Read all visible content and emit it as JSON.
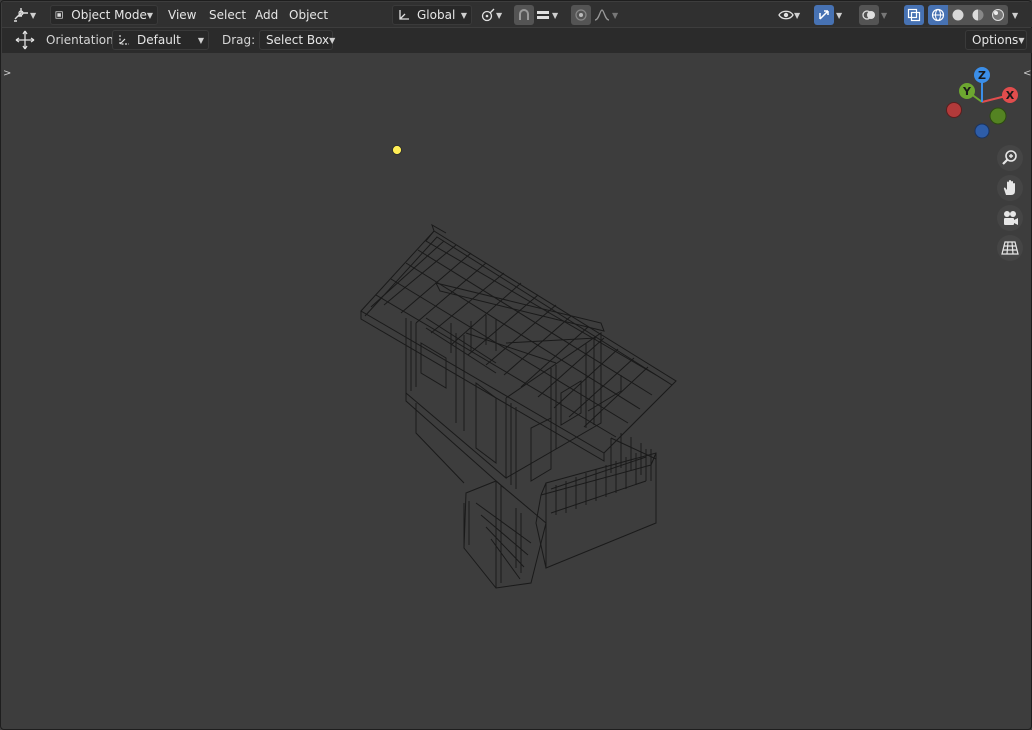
{
  "header": {
    "mode_label": "Object Mode",
    "menus": [
      "View",
      "Select",
      "Add",
      "Object"
    ],
    "transform_orientation": "Global"
  },
  "tool_settings": {
    "orientation_label": "Orientation:",
    "orientation_value": "Default",
    "drag_label": "Drag:",
    "drag_value": "Select Box",
    "options_label": "Options"
  },
  "gizmo": {
    "axes": [
      "X",
      "Y",
      "Z"
    ],
    "colors": {
      "x": "#e14d4d",
      "y": "#6da730",
      "z": "#3b8ee8",
      "x_neg": "#b33a3a",
      "y_neg": "#548322",
      "z_neg": "#2e5da8"
    }
  },
  "scene": {
    "light_color": "#ffee55",
    "wire_color": "#1a1a1a"
  },
  "colors": {
    "accent": "#4772b3",
    "viewport_bg": "#3d3d3d",
    "header_bg": "#303030"
  }
}
